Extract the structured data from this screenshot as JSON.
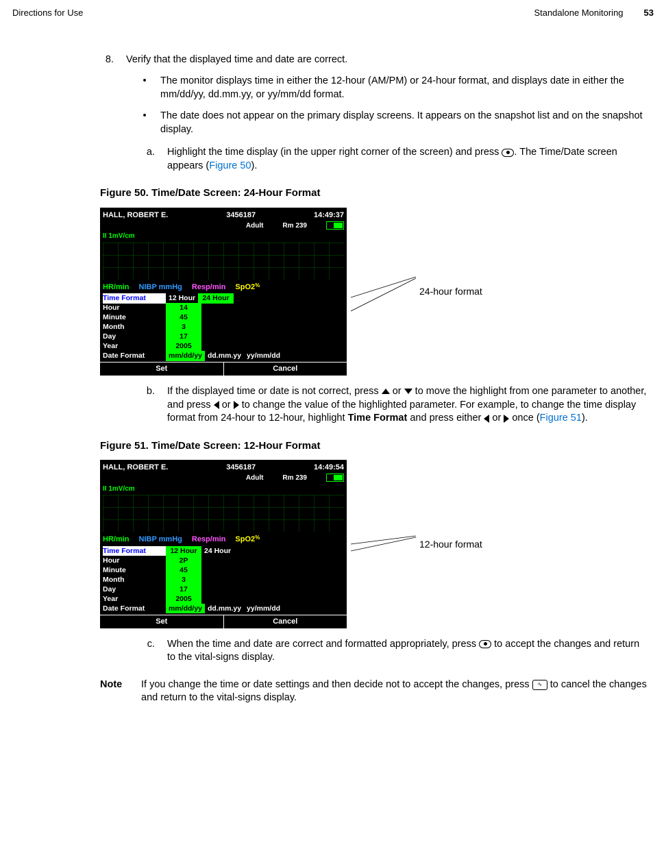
{
  "header": {
    "left": "Directions for Use",
    "section": "Standalone Monitoring",
    "page": "53"
  },
  "step8": {
    "num": "8.",
    "text": "Verify that the displayed time and date are correct.",
    "b1": "The monitor displays time in either the 12-hour (AM/PM) or 24-hour format, and displays date in either the mm/dd/yy, dd.mm.yy, or yy/mm/dd format.",
    "b2": "The date does not appear on the primary display screens. It appears on the snapshot list and on the snapshot display.",
    "a_lbl": "a.",
    "a_t1": "Highlight the time display (in the upper right corner of the screen) and press ",
    "a_t2": ". The Time/Date screen appears (",
    "a_link": "Figure 50",
    "a_t3": ")."
  },
  "fig50": {
    "cap": "Figure 50.  Time/Date Screen: 24-Hour Format",
    "callout": "24-hour format"
  },
  "mon1": {
    "name": "HALL, ROBERT E.",
    "id": "3456187",
    "time": "14:49:37",
    "mode": "Adult",
    "room": "Rm 239",
    "lead": "II    1mV/cm",
    "hr": "HR/min",
    "nibp": "NIBP mmHg",
    "resp": "Resp/min",
    "spo2": "SpO2",
    "rows": [
      {
        "lab": "Time Format",
        "sel": "24 Hour",
        "opts": [
          "12 Hour"
        ],
        "optsAfter": [],
        "hl": true,
        "selRight": true
      },
      {
        "lab": "Hour",
        "sel": "14"
      },
      {
        "lab": "Minute",
        "sel": "45"
      },
      {
        "lab": "Month",
        "sel": "3"
      },
      {
        "lab": "Day",
        "sel": "17"
      },
      {
        "lab": "Year",
        "sel": "2005"
      },
      {
        "lab": "Date Format",
        "sel": "mm/dd/yy",
        "optsAfter": [
          "dd.mm.yy",
          "yy/mm/dd"
        ]
      }
    ],
    "set": "Set",
    "cancel": "Cancel"
  },
  "stepb": {
    "lbl": "b.",
    "t1": "If the displayed time or date is not correct, press ",
    "t2": " or ",
    "t3": " to move the highlight from one parameter to another, and press ",
    "t4": " or ",
    "t5": " to change the value of the highlighted parameter. For example, to change the time display format from 24-hour to 12-hour, highlight ",
    "bold": "Time Format",
    "t6": " and press either ",
    "t7": " or ",
    "t8": " once (",
    "link": "Figure 51",
    "t9": ")."
  },
  "fig51": {
    "cap": "Figure 51.  Time/Date Screen: 12-Hour Format",
    "callout": "12-hour format"
  },
  "mon2": {
    "name": "HALL, ROBERT E.",
    "id": "3456187",
    "time": "14:49:54",
    "mode": "Adult",
    "room": "Rm 239",
    "lead": "II    1mV/cm",
    "hr": "HR/min",
    "nibp": "NIBP mmHg",
    "resp": "Resp/min",
    "spo2": "SpO2",
    "rows": [
      {
        "lab": "Time Format",
        "sel": "12 Hour",
        "optsAfter": [
          "24 Hour"
        ],
        "hl": true
      },
      {
        "lab": "Hour",
        "sel": "2P"
      },
      {
        "lab": "Minute",
        "sel": "45"
      },
      {
        "lab": "Month",
        "sel": "3"
      },
      {
        "lab": "Day",
        "sel": "17"
      },
      {
        "lab": "Year",
        "sel": "2005"
      },
      {
        "lab": "Date Format",
        "sel": "mm/dd/yy",
        "optsAfter": [
          "dd.mm.yy",
          "yy/mm/dd"
        ]
      }
    ],
    "set": "Set",
    "cancel": "Cancel"
  },
  "stepc": {
    "lbl": "c.",
    "t1": "When the time and date are correct and formatted appropriately, press ",
    "t2": " to accept the changes and return to the vital-signs display."
  },
  "note": {
    "lbl": "Note",
    "t1": "If you change the time or date settings and then decide not to accept the changes, press ",
    "t2": " to cancel the changes and return to the vital-signs display."
  }
}
